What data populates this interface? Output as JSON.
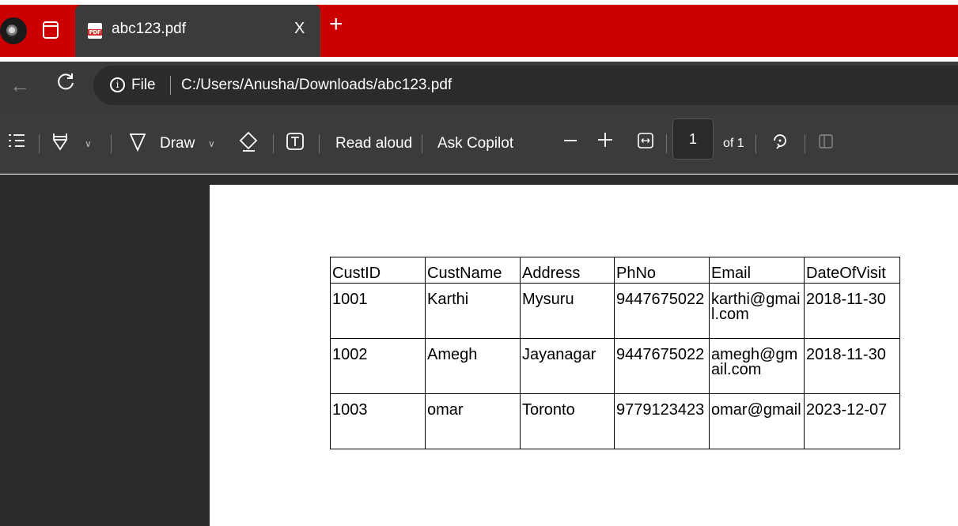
{
  "tab": {
    "title": "abc123.pdf",
    "close": "X",
    "new_tab": "+",
    "file_badge": "PDF"
  },
  "address": {
    "scheme_label": "File",
    "url": "C:/Users/Anusha/Downloads/abc123.pdf"
  },
  "toolbar": {
    "draw_label": "Draw",
    "read_aloud_label": "Read aloud",
    "ask_copilot_label": "Ask Copilot",
    "current_page": "1",
    "page_total": "of 1"
  },
  "table": {
    "headers": [
      "CustID",
      "CustName",
      "Address",
      "PhNo",
      "Email",
      "DateOfVisit"
    ],
    "rows": [
      [
        "1001",
        "Karthi",
        "Mysuru",
        "9447675022",
        "karthi@gmail.com",
        "2018-11-30"
      ],
      [
        "1002",
        "Amegh",
        "Jayanagar",
        "9447675022",
        "amegh@gmail.com",
        "2018-11-30"
      ],
      [
        "1003",
        "omar",
        "Toronto",
        "9779123423",
        "omar@gmail",
        "2023-12-07"
      ]
    ]
  },
  "colors": {
    "tab_strip": "#cc0000",
    "active_tab": "#3b3b3b",
    "toolbar": "#3b3b3b",
    "viewer_bg": "#2b2b2b"
  }
}
